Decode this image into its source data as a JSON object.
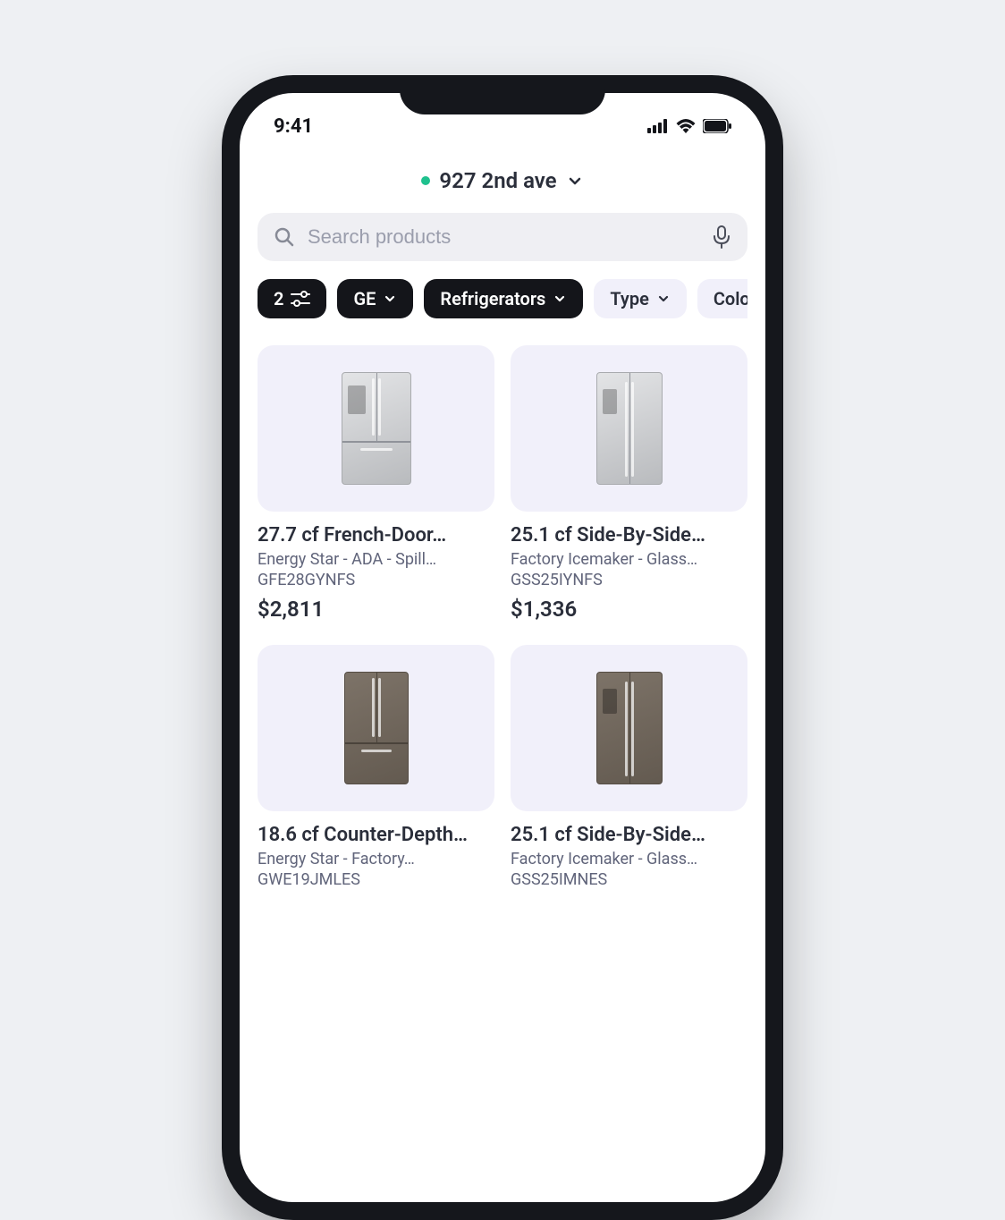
{
  "status": {
    "time": "9:41"
  },
  "location": {
    "address": "927 2nd ave"
  },
  "search": {
    "placeholder": "Search products"
  },
  "filters": {
    "count": "2",
    "chips": [
      {
        "label": "GE",
        "active": true
      },
      {
        "label": "Refrigerators",
        "active": true
      },
      {
        "label": "Type",
        "active": false
      },
      {
        "label": "Color",
        "active": false
      }
    ]
  },
  "products": [
    {
      "title": "27.7 cf French-Door…",
      "subtitle": "Energy Star - ADA - Spill…",
      "sku": "GFE28GYNFS",
      "price": "$2,811"
    },
    {
      "title": "25.1 cf Side-By-Side…",
      "subtitle": "Factory Icemaker - Glass…",
      "sku": "GSS25IYNFS",
      "price": "$1,336"
    },
    {
      "title": "18.6 cf Counter-Depth…",
      "subtitle": "Energy Star - Factory…",
      "sku": "GWE19JMLES",
      "price": ""
    },
    {
      "title": "25.1 cf Side-By-Side…",
      "subtitle": "Factory Icemaker - Glass…",
      "sku": "GSS25IMNES",
      "price": ""
    }
  ]
}
